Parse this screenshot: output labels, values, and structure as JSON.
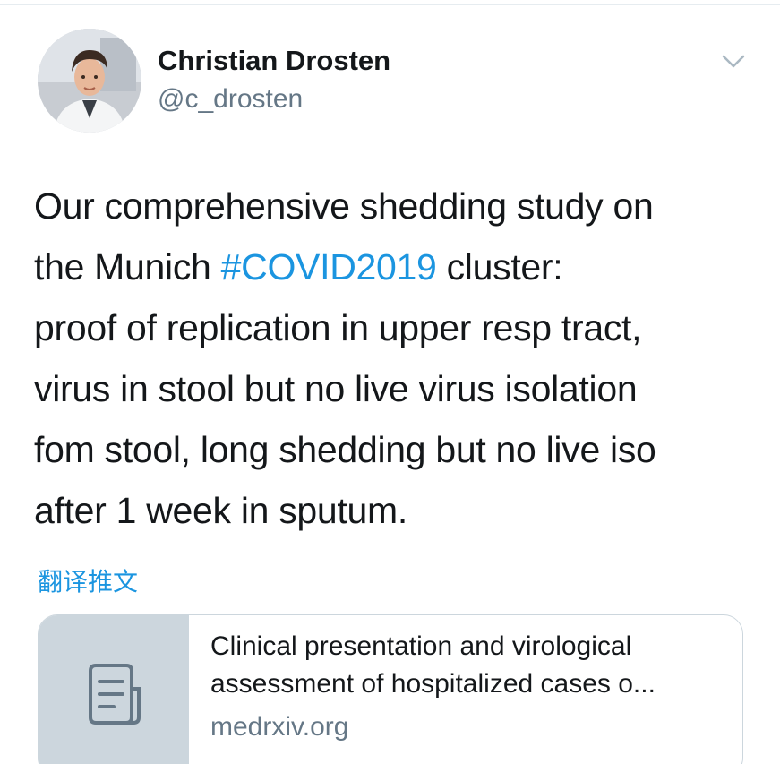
{
  "author": {
    "display_name": "Christian Drosten",
    "handle": "@c_drosten"
  },
  "tweet": {
    "line1": "Our comprehensive shedding study on",
    "line2_pre": "the Munich ",
    "hashtag": "#COVID2019",
    "line2_post": " cluster:",
    "line3": "proof of replication in upper resp tract,",
    "line4": "virus in stool but no live virus isolation",
    "line5": "fom stool, long shedding but no live iso",
    "line6": "after 1 week in sputum."
  },
  "translate_label": "翻译推文",
  "card": {
    "title_line1": "Clinical presentation and virological",
    "title_line2": "assessment of hospitalized cases o...",
    "domain": "medrxiv.org",
    "icon": "document-icon"
  },
  "icons": {
    "menu_caret": "chevron-down-icon"
  },
  "colors": {
    "link": "#1b95e0",
    "secondary_text": "#657786",
    "primary_text": "#14171a",
    "card_border": "#ccd6dd",
    "card_thumb_bg": "#ccd6dd"
  }
}
